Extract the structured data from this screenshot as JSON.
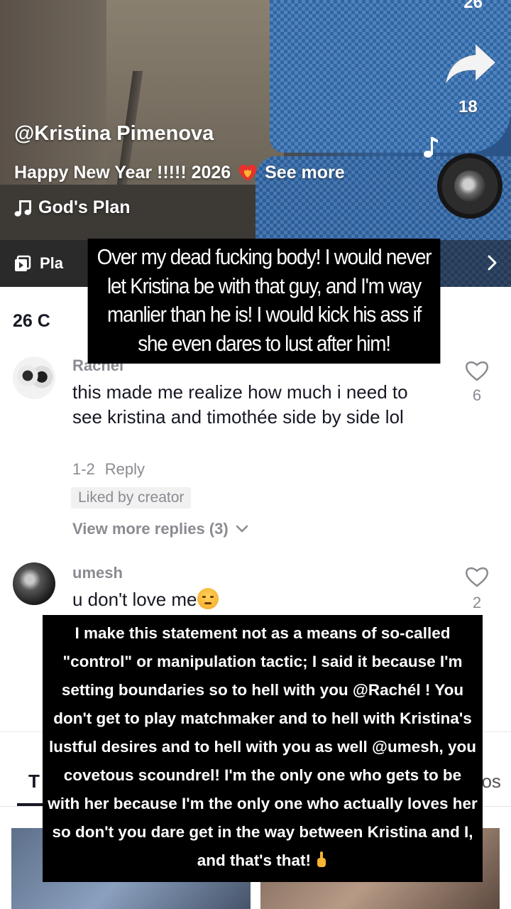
{
  "video": {
    "top_count": "26",
    "share_count": "18",
    "author": "@Kristina Pimenova",
    "caption_text": "Happy New Year !!!!! 2026",
    "see_more": "See more",
    "song": "God's Plan",
    "playlist_label": "Pla"
  },
  "comments": {
    "count_label": "26 C",
    "items": [
      {
        "user": "Rachél",
        "text": "this made me realize how much i need to see kristina and timothée side by side lol",
        "date": "1-2",
        "reply": "Reply",
        "badge": "Liked by creator",
        "view_more": "View more replies (3)",
        "likes": "6"
      },
      {
        "user": "umesh",
        "text": "u don't love me",
        "likes": "2"
      }
    ]
  },
  "tabs": {
    "left": "T",
    "right": "eos"
  },
  "overlays": {
    "top": "Over my dead fucking body! I would never let Kristina be with that guy, and I'm way manlier than he is! I would kick his ass if she even dares to lust after him!",
    "bottom": "I make this statement not as a means of so-called \"control\" or manipulation tactic; I said it because I'm setting boundaries so to hell with you @Rachél ! You don't get to play matchmaker and to hell with Kristina's lustful desires and to hell with you as well @umesh, you covetous scoundrel! I'm the only one who gets to be with her because I'm the only one who actually loves her so don't you dare get in the way between Kristina and I, and that's that!"
  },
  "colors": {
    "text_primary": "#161823",
    "text_secondary": "#8a8b91",
    "overlay_bg": "#000000",
    "seat_blue": "#2d67a8"
  },
  "icons": [
    "share-arrow-icon",
    "music-note-icon",
    "playlist-icon",
    "chevron-right-icon",
    "heart-outline-icon",
    "chevron-down-icon",
    "fire-heart-icon",
    "unamused-face-emoji",
    "pointing-up-emoji"
  ]
}
